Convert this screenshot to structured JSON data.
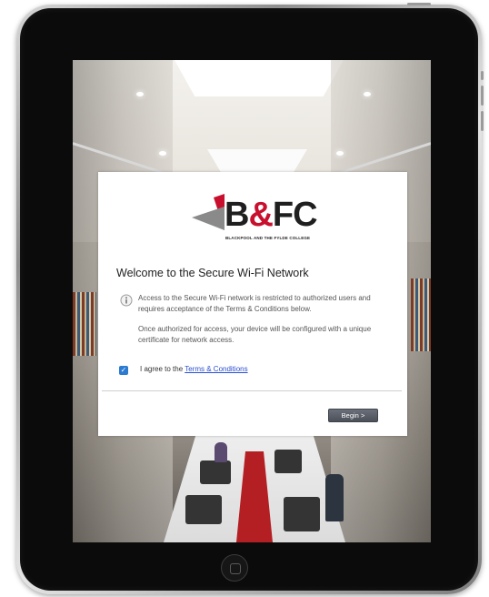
{
  "logo": {
    "letters_part1": "B",
    "letters_amp": "&",
    "letters_part2": "FC",
    "subtitle": "BLACKPOOL AND THE FYLDE COLLEGE",
    "colors": {
      "red": "#c8102e",
      "grey": "#8a8a8a",
      "text": "#1f1f1f"
    }
  },
  "dialog": {
    "title": "Welcome to the Secure Wi-Fi Network",
    "info_icon": "info-icon",
    "paragraphs": [
      "Access to the Secure Wi-Fi network is restricted to authorized users and requires acceptance of the Terms & Conditions below.",
      "Once authorized for access, your device will be configured with a unique certificate for network access."
    ],
    "agree_prefix": "I agree to the ",
    "agree_link": "Terms & Conditions",
    "checkbox_checked": true,
    "begin_label": "Begin >"
  },
  "colors": {
    "checkbox": "#2b7bd1",
    "link": "#2a4fd0",
    "button": "#555a63"
  }
}
